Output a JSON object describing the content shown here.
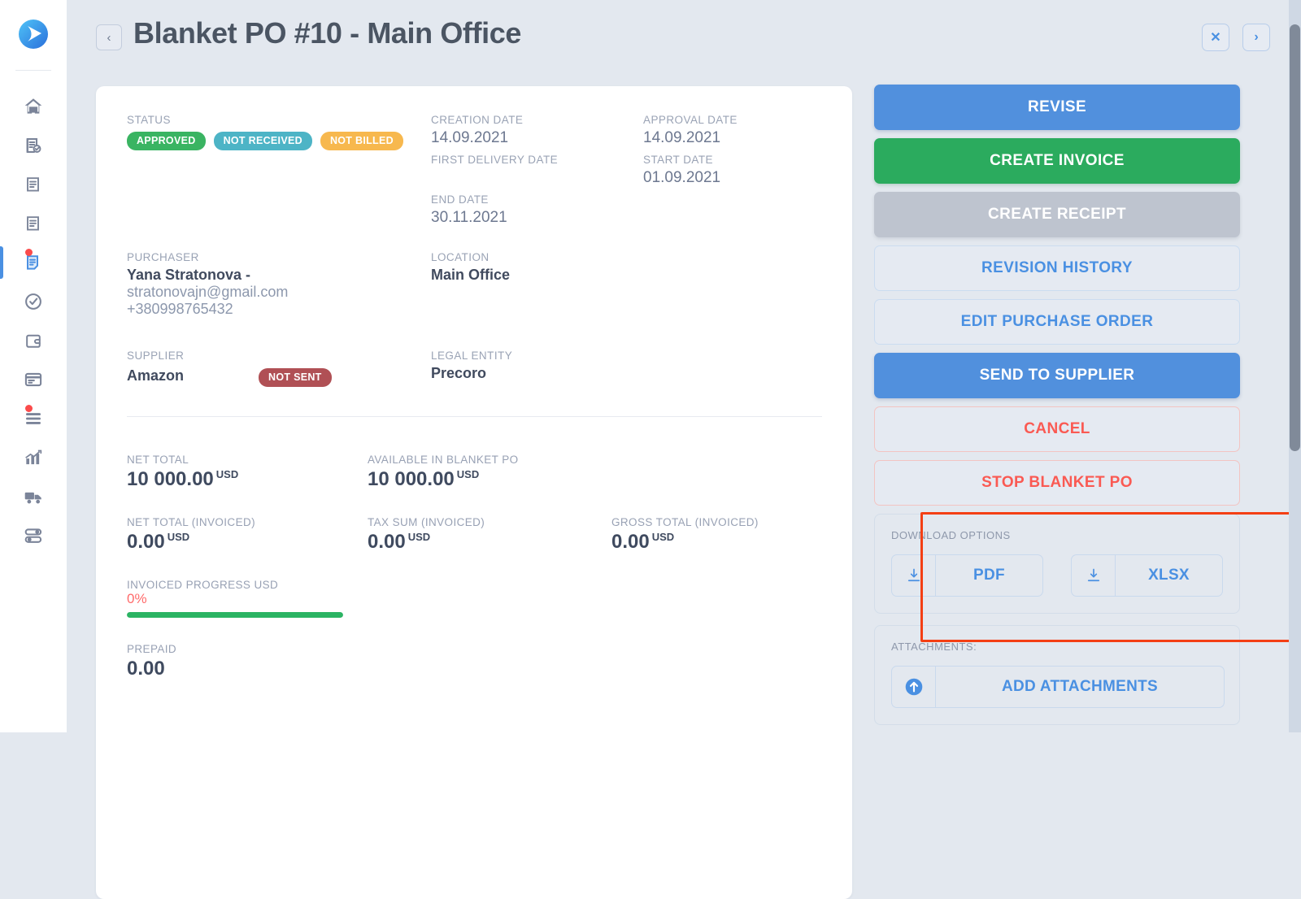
{
  "rail": {
    "logo_icon": "precoro-logo-icon",
    "items": [
      {
        "icon": "home-icon",
        "name": "home",
        "active": false,
        "dot": false
      },
      {
        "icon": "document-check-icon",
        "name": "approvals",
        "active": false,
        "dot": false
      },
      {
        "icon": "document-lines-icon",
        "name": "requisitions",
        "active": false,
        "dot": false
      },
      {
        "icon": "document-lines-icon",
        "name": "orders",
        "active": false,
        "dot": false
      },
      {
        "icon": "document-active-icon",
        "name": "purchase-orders",
        "active": true,
        "dot": true
      },
      {
        "icon": "check-circle-icon",
        "name": "receipts",
        "active": false,
        "dot": false
      },
      {
        "icon": "wallet-icon",
        "name": "invoices",
        "active": false,
        "dot": false
      },
      {
        "icon": "card-icon",
        "name": "expenses",
        "active": false,
        "dot": false
      },
      {
        "icon": "list-icon",
        "name": "catalog",
        "active": false,
        "dot": true
      },
      {
        "icon": "chart-bar-icon",
        "name": "reports",
        "active": false,
        "dot": false
      },
      {
        "icon": "truck-icon",
        "name": "suppliers",
        "active": false,
        "dot": false
      },
      {
        "icon": "toggles-icon",
        "name": "settings",
        "active": false,
        "dot": false
      }
    ]
  },
  "header": {
    "back_icon": "chevron-left-icon",
    "title": "Blanket PO #10 - Main Office",
    "close_icon": "close-icon",
    "close_label": "✕",
    "next_icon": "chevron-right-icon",
    "next_label": "›",
    "back_label": "‹"
  },
  "details": {
    "status": {
      "label": "STATUS",
      "badges": [
        {
          "text": "APPROVED",
          "color": "#3ab462"
        },
        {
          "text": "NOT RECEIVED",
          "color": "#4db4c6"
        },
        {
          "text": "NOT BILLED",
          "color": "#f7b84e"
        }
      ]
    },
    "creation_date": {
      "label": "CREATION DATE",
      "value": "14.09.2021"
    },
    "approval_date": {
      "label": "APPROVAL DATE",
      "value": "14.09.2021"
    },
    "first_delivery": {
      "label": "FIRST DELIVERY DATE",
      "value": ""
    },
    "start_date": {
      "label": "START DATE",
      "value": "01.09.2021"
    },
    "end_date": {
      "label": "END DATE",
      "value": "30.11.2021"
    },
    "purchaser": {
      "label": "PURCHASER",
      "name": "Yana Stratonova -",
      "email": "stratonovajn@gmail.com",
      "phone": "+380998765432"
    },
    "location": {
      "label": "LOCATION",
      "value": "Main Office"
    },
    "supplier": {
      "label": "SUPPLIER",
      "value": "Amazon",
      "badge": {
        "text": "NOT SENT",
        "color": "#b05055"
      }
    },
    "legal_entity": {
      "label": "LEGAL ENTITY",
      "value": "Precoro"
    }
  },
  "totals": {
    "net_total": {
      "label": "NET TOTAL",
      "value": "10 000.00",
      "currency": "USD"
    },
    "available_blanket": {
      "label": "AVAILABLE IN BLANKET PO",
      "value": "10 000.00",
      "currency": "USD"
    },
    "net_total_invoiced": {
      "label": "NET TOTAL (INVOICED)",
      "value": "0.00",
      "currency": "USD"
    },
    "tax_sum_invoiced": {
      "label": "TAX SUM (INVOICED)",
      "value": "0.00",
      "currency": "USD"
    },
    "gross_total_invoiced": {
      "label": "GROSS TOTAL (INVOICED)",
      "value": "0.00",
      "currency": "USD"
    },
    "invoiced_progress": {
      "label": "INVOICED PROGRESS USD",
      "percent": "0%",
      "fill_percent": 100,
      "bar_color": "#2bb463",
      "pct_color": "#ff6b6b"
    },
    "prepaid": {
      "label": "PREPAID",
      "value": "0.00"
    }
  },
  "actions": [
    {
      "label": "REVISE",
      "style": "solid-blue",
      "name": "revise-button"
    },
    {
      "label": "CREATE INVOICE",
      "style": "solid-green",
      "name": "create-invoice-button"
    },
    {
      "label": "CREATE RECEIPT",
      "style": "solid-gray",
      "name": "create-receipt-button"
    },
    {
      "label": "REVISION HISTORY",
      "style": "ghost-blue",
      "name": "revision-history-button"
    },
    {
      "label": "EDIT PURCHASE ORDER",
      "style": "ghost-blue",
      "name": "edit-purchase-order-button"
    },
    {
      "label": "SEND TO SUPPLIER",
      "style": "solid-blue",
      "name": "send-to-supplier-button"
    },
    {
      "label": "CANCEL",
      "style": "ghost-red",
      "name": "cancel-button"
    },
    {
      "label": "STOP BLANKET PO",
      "style": "ghost-red",
      "name": "stop-blanket-po-button"
    }
  ],
  "download": {
    "title": "DOWNLOAD OPTIONS",
    "pdf_label": "PDF",
    "xlsx_label": "XLSX",
    "download_icon": "download-icon",
    "highlight_color": "#f43f14"
  },
  "attachments": {
    "title": "ATTACHMENTS:",
    "add_label": "ADD ATTACHMENTS",
    "add_icon": "upload-circle-icon"
  }
}
